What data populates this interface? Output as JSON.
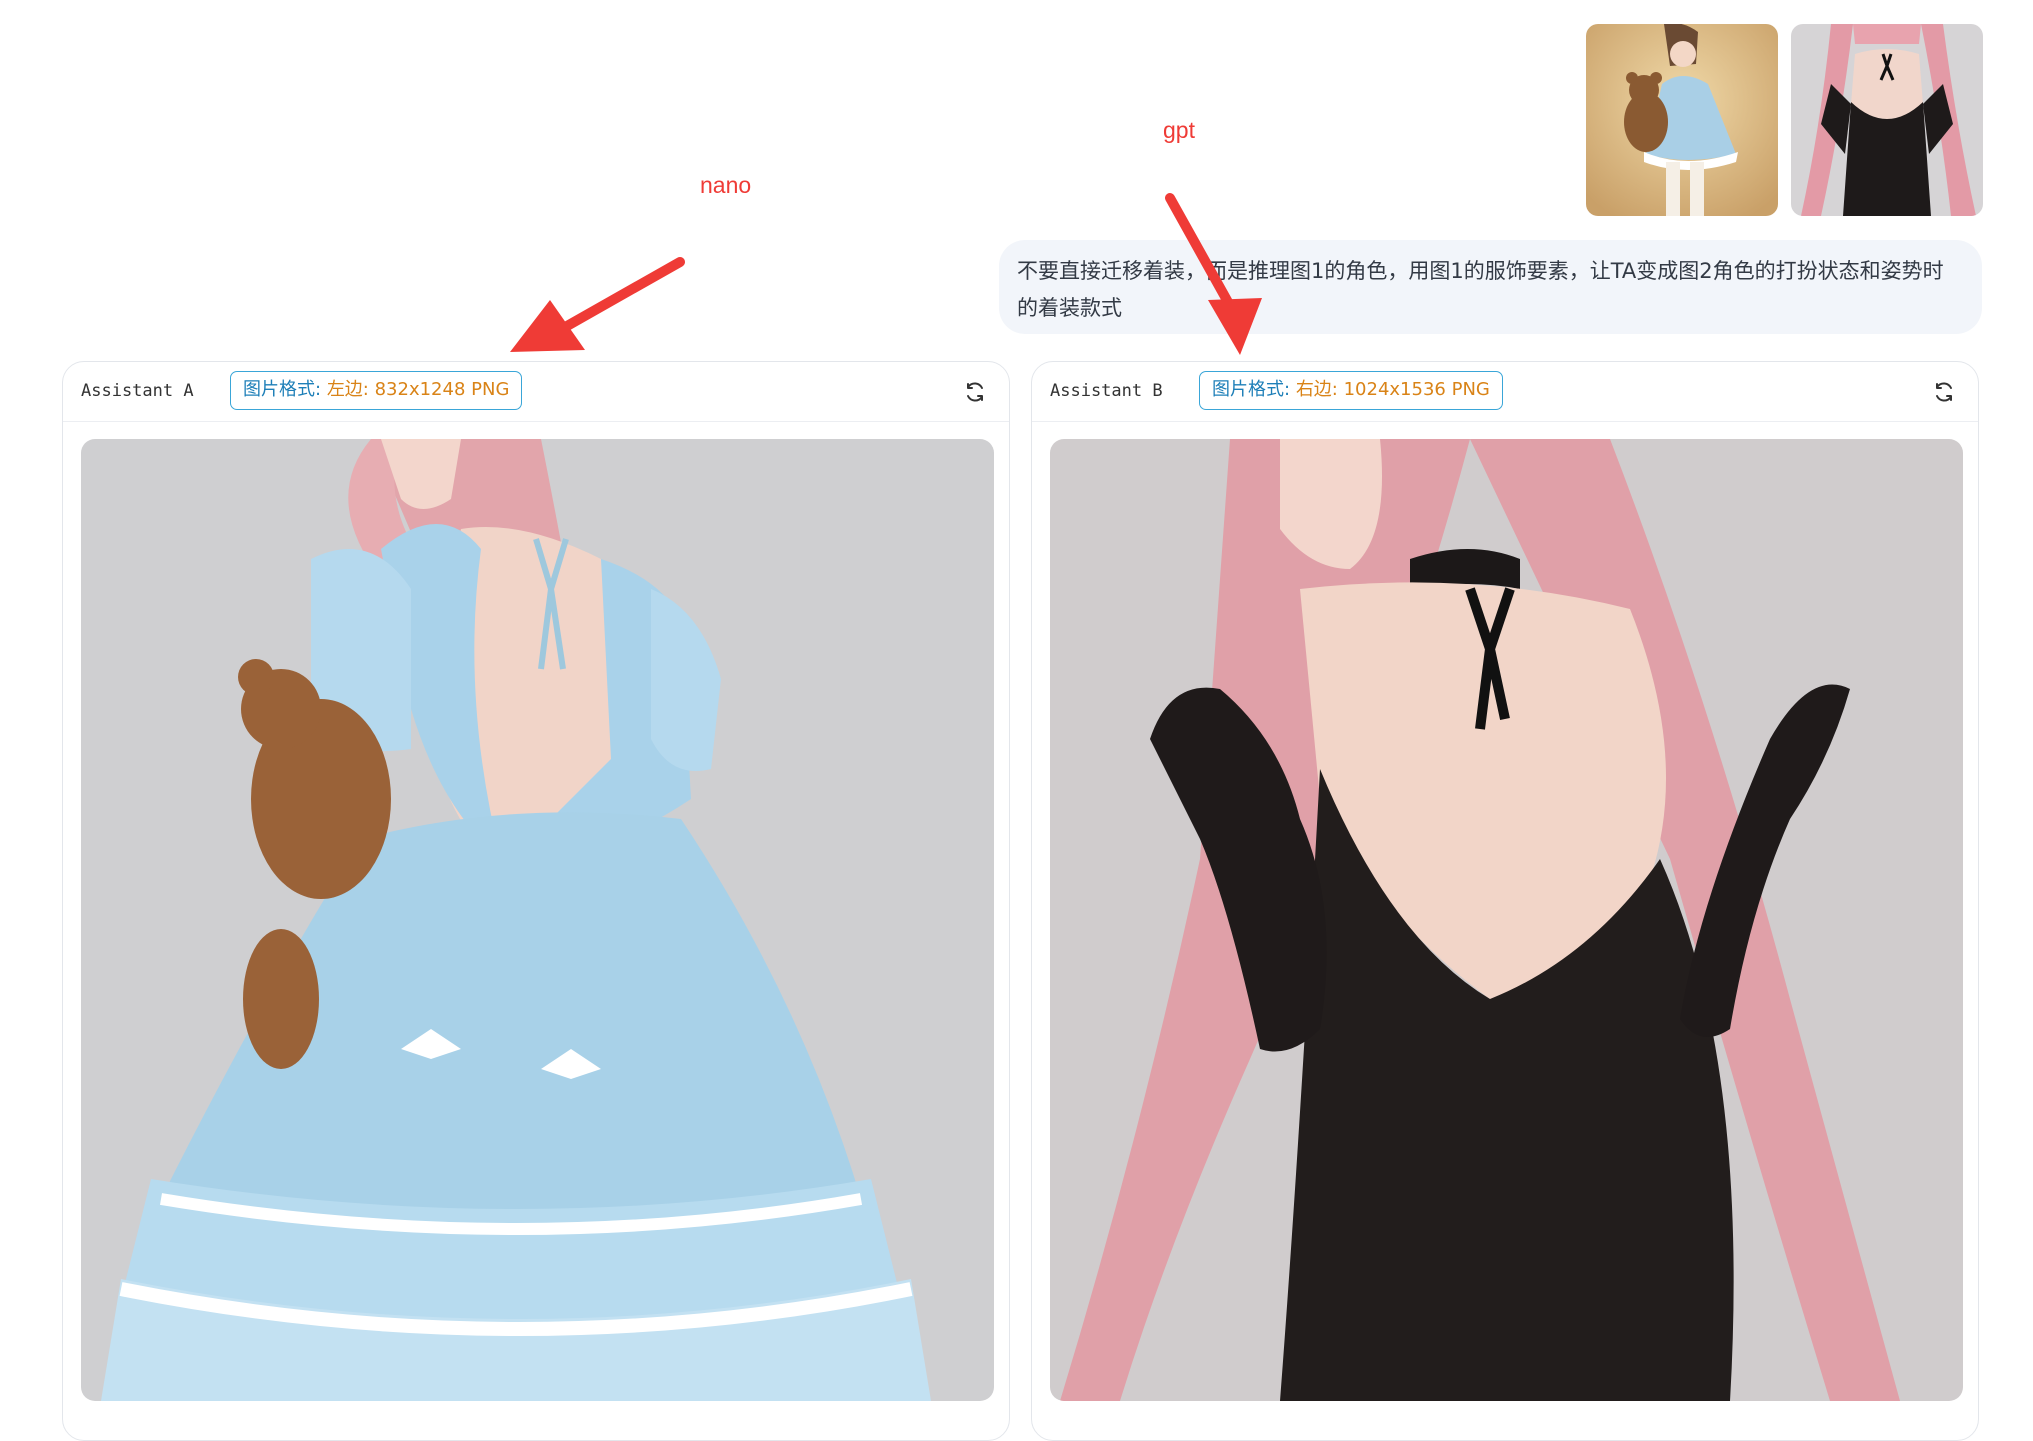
{
  "annotations": {
    "left_label": "nano",
    "right_label": "gpt"
  },
  "user_message": {
    "text": "不要直接迁移着装，而是推理图1的角色，用图1的服饰要素，让TA变成图2角色的打扮状态和姿势时的着装款式",
    "reference_images": [
      {
        "icon": "image-girl-teddy-bear-blue-dress"
      },
      {
        "icon": "image-girl-black-dress-back"
      }
    ]
  },
  "panels": [
    {
      "assistant": "Assistant A",
      "badge_label": "图片格式:",
      "badge_value": "左边: 832x1248 PNG",
      "refresh_icon": "refresh-icon",
      "image_icon": "image-pink-hair-blue-dress-back"
    },
    {
      "assistant": "Assistant B",
      "badge_label": "图片格式:",
      "badge_value": "右边: 1024x1536 PNG",
      "refresh_icon": "refresh-icon",
      "image_icon": "image-pink-hair-black-dress-back"
    }
  ],
  "colors": {
    "annotation": "#ef3b36",
    "badge_border": "#3aa6d8",
    "badge_value": "#d98317",
    "bubble_bg": "#f2f5fa"
  }
}
